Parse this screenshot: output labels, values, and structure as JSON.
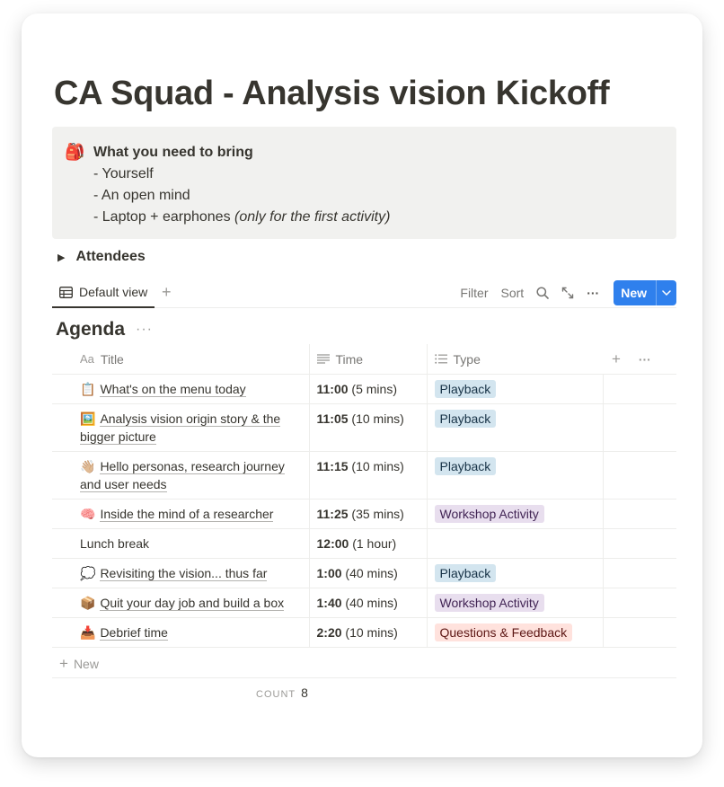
{
  "page": {
    "title": "CA Squad - Analysis vision Kickoff"
  },
  "callout": {
    "icon": "backpack-icon",
    "icon_glyph": "🎒",
    "heading": "What you need to bring",
    "items": [
      "- Yourself",
      "- An open mind",
      "- Laptop + earphones "
    ],
    "item3_note": "(only for the first activity)"
  },
  "toggle": {
    "label": "Attendees"
  },
  "viewbar": {
    "tab_label": "Default view",
    "add_view": "+",
    "filter": "Filter",
    "sort": "Sort",
    "more": "···",
    "new_label": "New"
  },
  "database": {
    "title": "Agenda",
    "title_more": "···",
    "columns": {
      "title": "Title",
      "title_icon": "Aa",
      "time": "Time",
      "type": "Type",
      "add": "+",
      "more": "···"
    },
    "rows": [
      {
        "emoji": "📋",
        "title": "What's on the menu today",
        "title2": "",
        "time_bold": "11:00",
        "time_rest": " (5 mins)",
        "type": "Playback"
      },
      {
        "emoji": "🖼️",
        "title": "Analysis vision origin story & the",
        "title2": "bigger picture",
        "time_bold": "11:05",
        "time_rest": " (10 mins)",
        "type": "Playback"
      },
      {
        "emoji": "👋🏼",
        "title": "Hello personas, research journey",
        "title2": "and user needs",
        "time_bold": "11:15",
        "time_rest": " (10 mins)",
        "type": "Playback"
      },
      {
        "emoji": "🧠",
        "title": "Inside the mind of a researcher",
        "title2": "",
        "time_bold": "11:25",
        "time_rest": " (35 mins)",
        "type": "Workshop Activity"
      },
      {
        "emoji": "",
        "title": "Lunch break",
        "title2": "",
        "time_bold": "12:00",
        "time_rest": " (1 hour)",
        "type": ""
      },
      {
        "emoji": "💭",
        "title": "Revisiting the vision... thus far",
        "title2": "",
        "time_bold": "1:00",
        "time_rest": " (40 mins)",
        "type": "Playback"
      },
      {
        "emoji": "📦",
        "title": "Quit your day job and build a box",
        "title2": "",
        "time_bold": "1:40",
        "time_rest": " (40 mins)",
        "type": "Workshop Activity"
      },
      {
        "emoji": "📥",
        "title": "Debrief time",
        "title2": "",
        "time_bold": "2:20",
        "time_rest": " (10 mins)",
        "type": "Questions & Feedback"
      }
    ],
    "new_row": "New",
    "count_label": "COUNT",
    "count_value": "8"
  },
  "colors": {
    "accent_blue": "#2f80ed",
    "tag_playback": "#d3e5ef",
    "tag_workshop": "#e8deee",
    "tag_questions": "#ffe2dd"
  }
}
